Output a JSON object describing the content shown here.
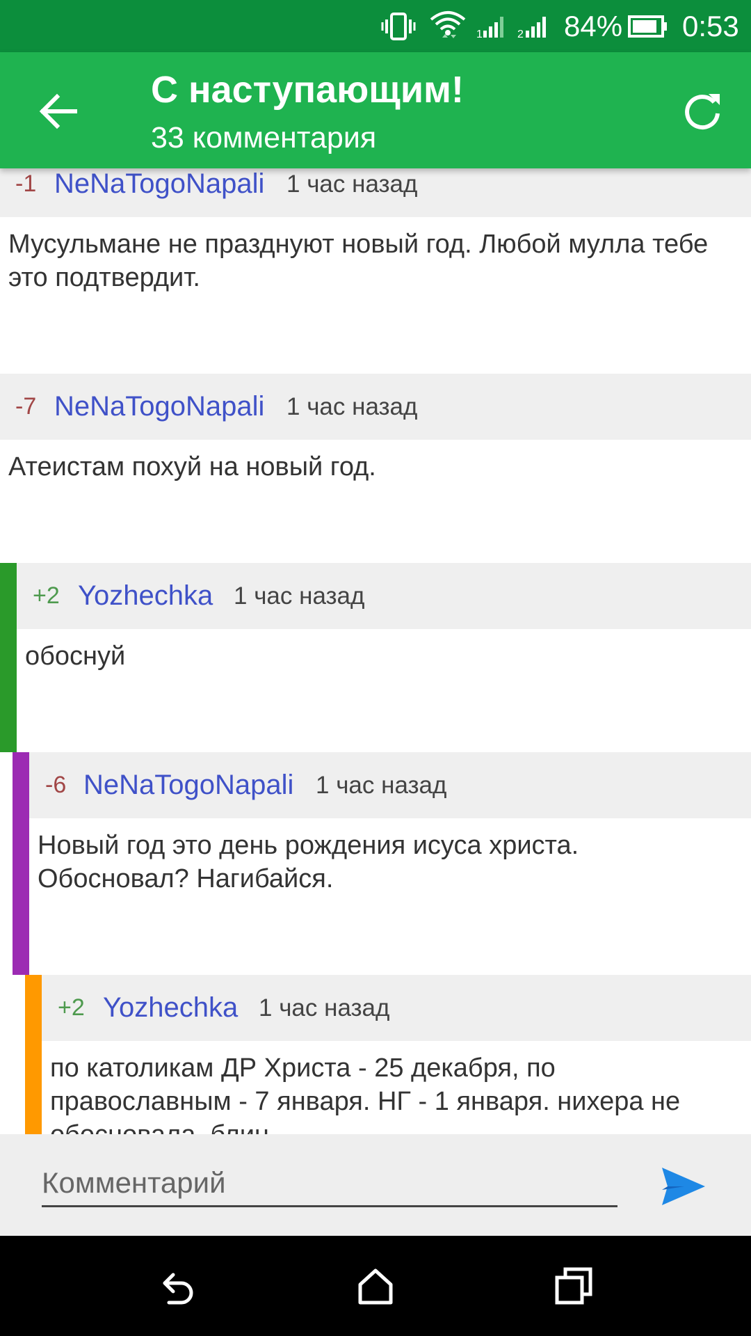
{
  "status_bar": {
    "battery": "84%",
    "time": "0:53",
    "icons": [
      "vibrate-icon",
      "wifi-icon",
      "signal-1-icon",
      "signal-2-icon",
      "battery-icon"
    ]
  },
  "app_bar": {
    "title": "С наступающим!",
    "subtitle": "33 комментария",
    "back_icon": "arrow-left-icon",
    "refresh_icon": "refresh-icon"
  },
  "comments": [
    {
      "score": "-1",
      "author": "NeNaTogoNapali",
      "time": "1 час назад",
      "text": "Мусульмане не празднуют новый год. Любой мулла тебе это подтвердит.",
      "depth": 0
    },
    {
      "score": "-7",
      "author": "NeNaTogoNapali",
      "time": "1 час назад",
      "text": "Атеистам похуй на новый год.",
      "depth": 0
    },
    {
      "score": "+2",
      "author": "Yozhechka",
      "time": "1 час назад",
      "text": "обоснуй",
      "depth": 1,
      "thread_color": "#2a9a2a"
    },
    {
      "score": "-6",
      "author": "NeNaTogoNapali",
      "time": "1 час назад",
      "text": "Новый год это день рождения исуса христа. Обосновал? Нагибайся.",
      "depth": 2,
      "thread_color": "#9c2bb3"
    },
    {
      "score": "+2",
      "author": "Yozhechka",
      "time": "1 час назад",
      "text": "по католикам ДР Христа - 25 декабря, по православным - 7 января. НГ - 1 января. нихера не обосновала, блин",
      "depth": 3,
      "thread_color": "#ff9900"
    }
  ],
  "composer": {
    "placeholder": "Комментарий",
    "send_icon": "send-icon"
  },
  "nav_bar": {
    "icons": [
      "back-nav-icon",
      "home-icon",
      "recents-icon"
    ]
  },
  "colors": {
    "status_bar": "#0c8e3c",
    "app_bar": "#1fb350",
    "author": "#3f51c8",
    "score_negative": "#a14646",
    "score_positive": "#4e9a4e",
    "send": "#1e88e5"
  }
}
